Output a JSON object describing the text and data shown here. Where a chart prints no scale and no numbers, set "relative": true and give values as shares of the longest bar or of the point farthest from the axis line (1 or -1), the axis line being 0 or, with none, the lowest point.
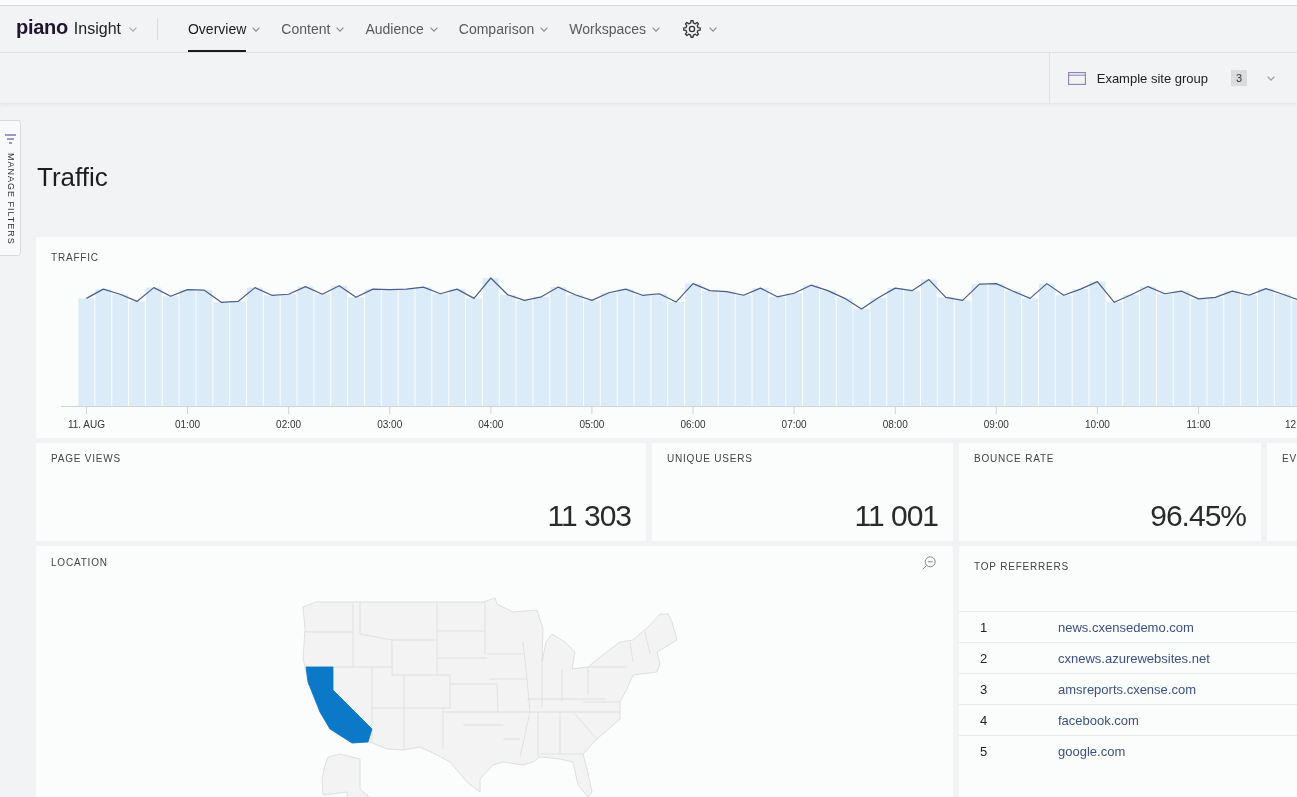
{
  "app": {
    "logo": "piano",
    "product": "Insight"
  },
  "nav": {
    "items": [
      {
        "label": "Overview",
        "selected": true
      },
      {
        "label": "Content",
        "selected": false
      },
      {
        "label": "Audience",
        "selected": false
      },
      {
        "label": "Comparison",
        "selected": false
      },
      {
        "label": "Workspaces",
        "selected": false
      }
    ]
  },
  "site_group": {
    "label": "Example site group",
    "count": "3"
  },
  "filters_tab": {
    "label": "MANAGE FILTERS"
  },
  "page_title": "Traffic",
  "traffic_card": {
    "title": "TRAFFIC",
    "chart_data": {
      "type": "bar",
      "relative": true,
      "categories": [
        "11. AUG",
        null,
        null,
        null,
        null,
        null,
        "01:00",
        null,
        null,
        null,
        null,
        null,
        "02:00",
        null,
        null,
        null,
        null,
        null,
        "03:00",
        null,
        null,
        null,
        null,
        null,
        "04:00",
        null,
        null,
        null,
        null,
        null,
        "05:00",
        null,
        null,
        null,
        null,
        null,
        "06:00",
        null,
        null,
        null,
        null,
        null,
        "07:00",
        null,
        null,
        null,
        null,
        null,
        "08:00",
        null,
        null,
        null,
        null,
        null,
        "09:00",
        null,
        null,
        null,
        null,
        null,
        "10:00",
        null,
        null,
        null,
        null,
        null,
        "11:00",
        null,
        null,
        null,
        null,
        null,
        "12"
      ],
      "series": [
        {
          "color": "#dcebf8",
          "values": [
            0.841,
            0.913,
            0.873,
            0.817,
            0.925,
            0.857,
            0.909,
            0.905,
            0.81,
            0.817,
            0.925,
            0.865,
            0.873,
            0.933,
            0.873,
            0.94,
            0.849,
            0.913,
            0.909,
            0.913,
            0.929,
            0.877,
            0.913,
            0.841,
            1.0,
            0.869,
            0.825,
            0.853,
            0.929,
            0.869,
            0.825,
            0.885,
            0.913,
            0.865,
            0.877,
            0.813,
            0.956,
            0.901,
            0.893,
            0.865,
            0.921,
            0.853,
            0.881,
            0.944,
            0.901,
            0.841,
            0.758,
            0.845,
            0.921,
            0.901,
            0.988,
            0.849,
            0.825,
            0.952,
            0.956,
            0.897,
            0.841,
            0.956,
            0.865,
            0.913,
            0.972,
            0.81,
            0.869,
            0.933,
            0.877,
            0.897,
            0.837,
            0.849,
            0.897,
            0.865,
            0.917,
            0.873,
            0.825
          ]
        }
      ]
    }
  },
  "kpis": [
    {
      "label": "PAGE VIEWS",
      "value": "11 303"
    },
    {
      "label": "UNIQUE USERS",
      "value": "11 001"
    },
    {
      "label": "BOUNCE RATE",
      "value": "96.45%"
    },
    {
      "label": "EV"
    }
  ],
  "location": {
    "title": "LOCATION",
    "map": {
      "kind": "us_states",
      "highlighted": [
        {
          "kind": "california"
        }
      ]
    }
  },
  "top_referrers": {
    "title": "TOP REFERRERS",
    "rows": [
      {
        "rank": "1",
        "referrer": "news.cxensedemo.com"
      },
      {
        "rank": "2",
        "referrer": "cxnews.azurewebsites.net"
      },
      {
        "rank": "3",
        "referrer": "amsreports.cxense.com"
      },
      {
        "rank": "4",
        "referrer": "facebook.com"
      },
      {
        "rank": "5",
        "referrer": "google.com"
      }
    ]
  }
}
